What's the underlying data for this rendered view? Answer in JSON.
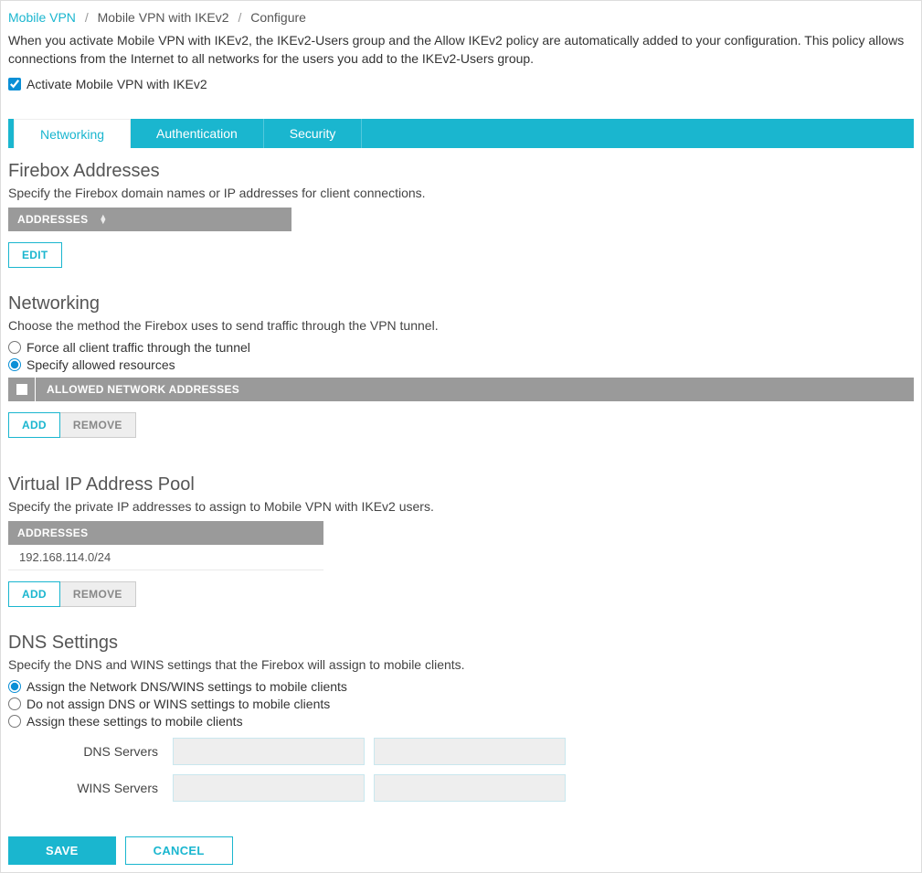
{
  "breadcrumb": {
    "root": "Mobile VPN",
    "mid": "Mobile VPN with IKEv2",
    "leaf": "Configure"
  },
  "intro": "When you activate Mobile VPN with IKEv2, the IKEv2-Users group and the Allow IKEv2 policy are automatically added to your configuration. This policy allows connections from the Internet to all networks for the users you add to the IKEv2-Users group.",
  "activate_label": "Activate Mobile VPN with IKEv2",
  "tabs": {
    "networking": "Networking",
    "authentication": "Authentication",
    "security": "Security"
  },
  "firebox": {
    "title": "Firebox Addresses",
    "desc": "Specify the Firebox domain names or IP addresses for client connections.",
    "col_header": "ADDRESSES",
    "edit": "EDIT"
  },
  "networking": {
    "title": "Networking",
    "desc": "Choose the method the Firebox uses to send traffic through the VPN tunnel.",
    "opt_force": "Force all client traffic through the tunnel",
    "opt_allowed": "Specify allowed resources",
    "col_header": "ALLOWED NETWORK ADDRESSES",
    "add": "ADD",
    "remove": "REMOVE"
  },
  "vip": {
    "title": "Virtual IP Address Pool",
    "desc": "Specify the private IP addresses to assign to Mobile VPN with IKEv2 users.",
    "col_header": "ADDRESSES",
    "rows": [
      "192.168.114.0/24"
    ],
    "add": "ADD",
    "remove": "REMOVE"
  },
  "dns": {
    "title": "DNS Settings",
    "desc": "Specify the DNS and WINS settings that the Firebox will assign to mobile clients.",
    "opt_assign_network": "Assign the Network DNS/WINS settings to mobile clients",
    "opt_no_assign": "Do not assign DNS or WINS settings to mobile clients",
    "opt_assign_these": "Assign these settings to mobile clients",
    "dns_servers_label": "DNS Servers",
    "wins_servers_label": "WINS Servers"
  },
  "footer": {
    "save": "SAVE",
    "cancel": "CANCEL"
  }
}
